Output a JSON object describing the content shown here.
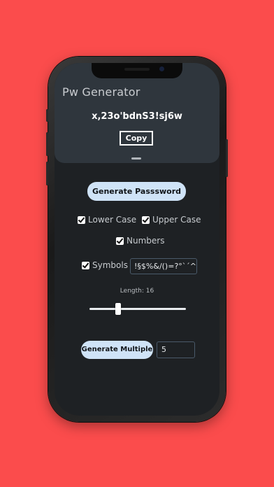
{
  "app": {
    "title": "Pw Generator",
    "password": "x,23o'bdnS3!sj6w",
    "copy_label": "Copy"
  },
  "controls": {
    "generate_label": "Generate Passsword",
    "options": {
      "lower_case": {
        "label": "Lower Case",
        "checked": true
      },
      "upper_case": {
        "label": "Upper Case",
        "checked": true
      },
      "numbers": {
        "label": "Numbers",
        "checked": true
      },
      "symbols": {
        "label": "Symbols",
        "checked": true
      }
    },
    "symbols_value": "!§$%&/()=?°`´^+*",
    "length_label": "Length: 16",
    "length": {
      "value": 16,
      "min": 4,
      "max": 64
    },
    "generate_multiple_label": "Generate Multiple",
    "multiple_count": "5"
  },
  "colors": {
    "background": "#fb4c4c",
    "screen": "#1e2124",
    "header": "#2f363d",
    "button": "#cfe3f7"
  }
}
